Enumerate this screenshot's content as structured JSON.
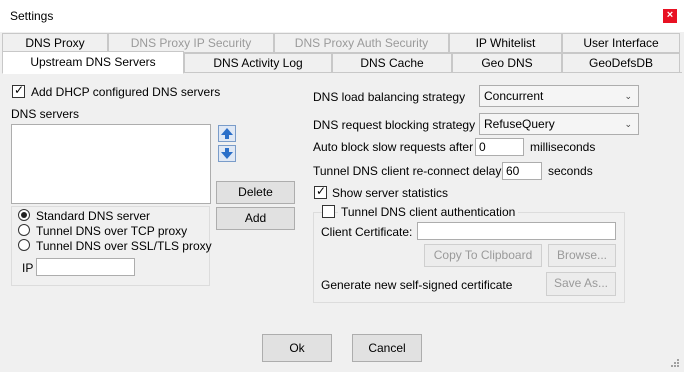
{
  "window": {
    "title": "Settings"
  },
  "tabs_row1": [
    {
      "label": "DNS Proxy",
      "disabled": false
    },
    {
      "label": "DNS Proxy IP Security",
      "disabled": true
    },
    {
      "label": "DNS Proxy Auth Security",
      "disabled": true
    },
    {
      "label": "IP Whitelist",
      "disabled": false
    },
    {
      "label": "User Interface",
      "disabled": false
    }
  ],
  "tabs_row2": [
    {
      "label": "Upstream DNS Servers",
      "active": true
    },
    {
      "label": "DNS Activity Log",
      "active": false
    },
    {
      "label": "DNS Cache",
      "active": false
    },
    {
      "label": "Geo DNS",
      "active": false
    },
    {
      "label": "GeoDefsDB",
      "active": false
    }
  ],
  "left": {
    "add_dhcp_label": "Add DHCP configured DNS servers",
    "add_dhcp_checked": true,
    "dns_servers_label": "DNS servers",
    "delete_label": "Delete",
    "add_label": "Add",
    "radios": [
      {
        "label": "Standard DNS server",
        "selected": true
      },
      {
        "label": "Tunnel DNS over TCP proxy",
        "selected": false
      },
      {
        "label": "Tunnel DNS over SSL/TLS proxy",
        "selected": false
      }
    ],
    "ip_label": "IP",
    "ip_value": ""
  },
  "right": {
    "load_balancing_label": "DNS load balancing strategy",
    "load_balancing_value": "Concurrent",
    "blocking_label": "DNS request blocking strategy",
    "blocking_value": "RefuseQuery",
    "auto_block_label": "Auto block slow requests after",
    "auto_block_value": "0",
    "auto_block_unit": "milliseconds",
    "reconnect_label": "Tunnel DNS client re-connect delay",
    "reconnect_value": "60",
    "reconnect_unit": "seconds",
    "show_stats_label": "Show server statistics",
    "show_stats_checked": true,
    "tunnel_auth_label": "Tunnel DNS client authentication",
    "tunnel_auth_checked": false,
    "client_cert_label": "Client Certificate:",
    "client_cert_value": "",
    "copy_clipboard_label": "Copy To Clipboard",
    "browse_label": "Browse...",
    "generate_label": "Generate new self-signed certificate",
    "save_as_label": "Save As..."
  },
  "footer": {
    "ok_label": "Ok",
    "cancel_label": "Cancel"
  }
}
